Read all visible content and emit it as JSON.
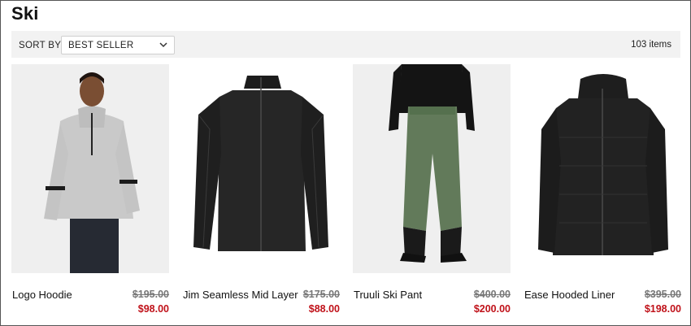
{
  "page": {
    "title": "Ski"
  },
  "toolbar": {
    "sort_label": "SORT BY:",
    "sort_value": "BEST SELLER",
    "items_count": "103 items"
  },
  "products": [
    {
      "name": "Logo Hoodie",
      "original_price": "$195.00",
      "sale_price": "$98.00",
      "image": "model-wearing-grey-hoodie"
    },
    {
      "name": "Jim Seamless Mid Layer",
      "original_price": "$175.00",
      "sale_price": "$88.00",
      "image": "black-zip-mid-layer-jacket"
    },
    {
      "name": "Truuli Ski Pant",
      "original_price": "$400.00",
      "sale_price": "$200.00",
      "image": "green-ski-pants-on-model"
    },
    {
      "name": "Ease Hooded Liner",
      "original_price": "$395.00",
      "sale_price": "$198.00",
      "image": "black-quilted-hooded-jacket"
    }
  ],
  "colors": {
    "sale_price": "#c0121a",
    "toolbar_bg": "#f2f2f2",
    "image_bg": "#efefef"
  }
}
